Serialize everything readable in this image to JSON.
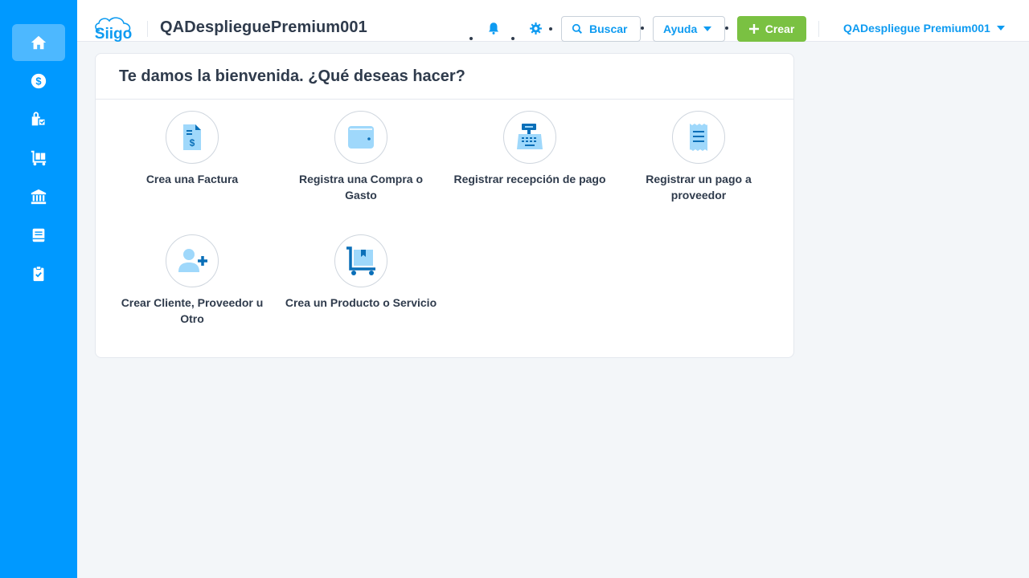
{
  "sidebar": {
    "items": [
      {
        "icon": "home-icon",
        "active": true
      },
      {
        "icon": "dollar-circle-icon",
        "active": false
      },
      {
        "icon": "shopping-bag-icon",
        "active": false
      },
      {
        "icon": "cart-dolly-icon",
        "active": false
      },
      {
        "icon": "bank-icon",
        "active": false
      },
      {
        "icon": "book-icon",
        "active": false
      },
      {
        "icon": "clipboard-check-icon",
        "active": false
      }
    ]
  },
  "header": {
    "logo_text": "Siigo",
    "company_name": "QADesplieguePremium001",
    "search_label": "Buscar",
    "help_label": "Ayuda",
    "create_label": "Crear",
    "user_label": "QADespliegue Premium001"
  },
  "welcome": {
    "title": "Te damos la bienvenida. ¿Qué deseas hacer?",
    "actions": [
      {
        "label": "Crea una Factura",
        "icon": "invoice-icon"
      },
      {
        "label": "Registra una Compra o Gasto",
        "icon": "wallet-icon"
      },
      {
        "label": "Registrar recepción de pago",
        "icon": "cash-register-icon"
      },
      {
        "label": "Registrar un pago a proveedor",
        "icon": "receipt-icon"
      },
      {
        "label": "Crear Cliente, Proveedor u Otro",
        "icon": "add-user-icon"
      },
      {
        "label": "Crea un Producto o Servicio",
        "icon": "product-dolly-icon"
      }
    ]
  },
  "colors": {
    "sidebar": "#0099ff",
    "sidebar_active": "#4db8ff",
    "accent": "#0e9bf1",
    "create_button": "#7ac142",
    "icon_light": "#9fd8fb",
    "icon_dark": "#0a6fb8"
  }
}
